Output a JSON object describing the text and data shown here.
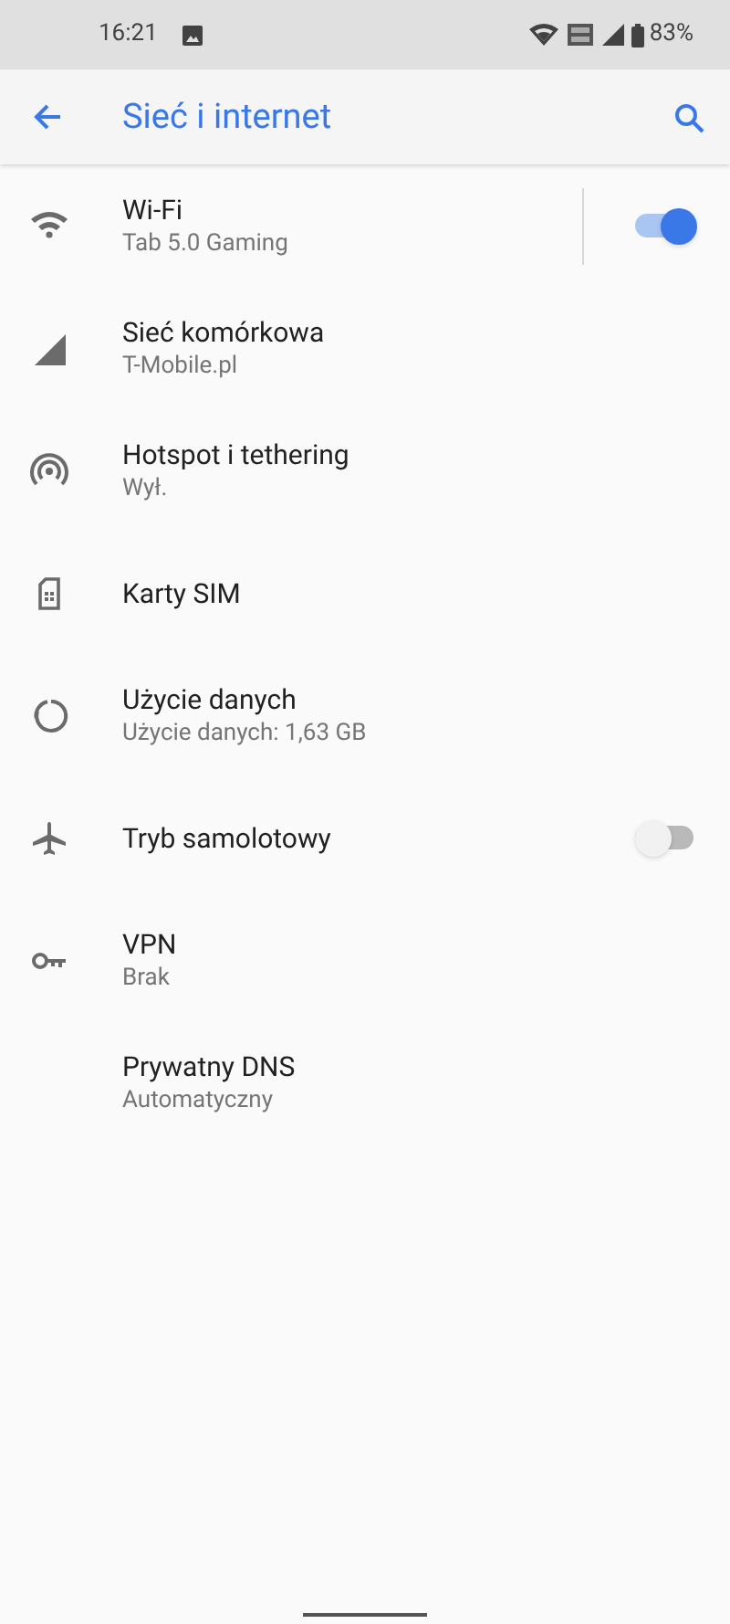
{
  "status_bar": {
    "time": "16:21",
    "battery": "83%"
  },
  "header": {
    "title": "Sieć i internet"
  },
  "items": [
    {
      "kind": "wifi",
      "title": "Wi-Fi",
      "subtitle": "Tab 5.0 Gaming",
      "switch": {
        "on": true
      }
    },
    {
      "kind": "signal",
      "title": "Sieć komórkowa",
      "subtitle": "T-Mobile.pl"
    },
    {
      "kind": "hotspot",
      "title": "Hotspot i tethering",
      "subtitle": "Wył."
    },
    {
      "kind": "sim",
      "title": "Karty SIM"
    },
    {
      "kind": "data",
      "title": "Użycie danych",
      "subtitle": "Użycie danych: 1,63 GB"
    },
    {
      "kind": "airplane",
      "title": "Tryb samolotowy",
      "switch": {
        "on": false
      }
    },
    {
      "kind": "key",
      "title": "VPN",
      "subtitle": "Brak"
    },
    {
      "kind": "dns",
      "title": "Prywatny DNS",
      "subtitle": "Automatyczny"
    }
  ]
}
